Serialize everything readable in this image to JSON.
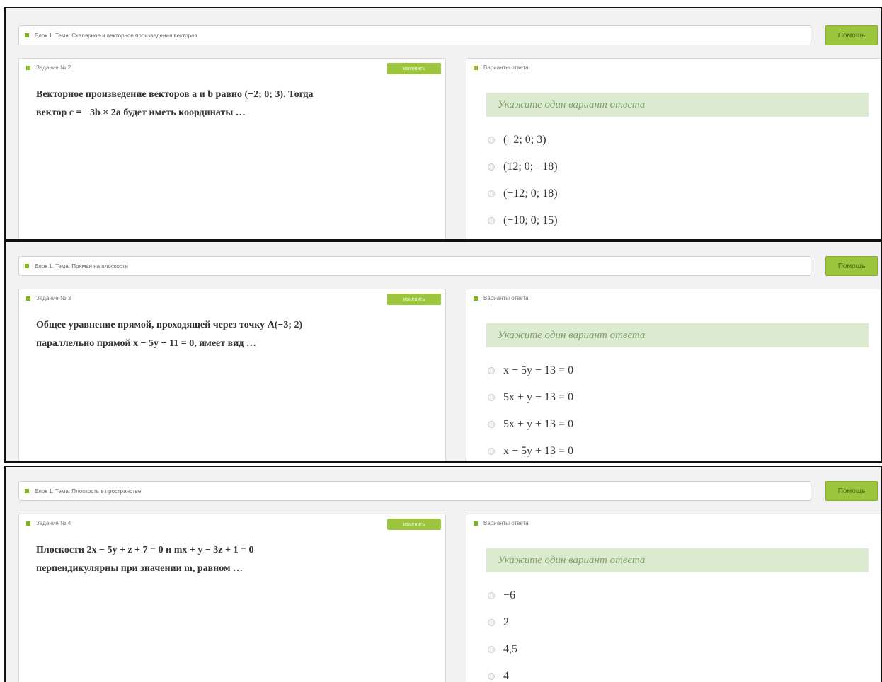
{
  "common": {
    "help_label": "Помощь",
    "change_label": "изменить",
    "answers_heading": "Варианты ответа",
    "hint": "Укажите один вариант ответа"
  },
  "screens": [
    {
      "topic": "Блок 1. Тема: Скалярное и векторное произведения векторов",
      "task_label": "Задание № 2",
      "question_line1": "Векторное произведение векторов a и b равно (−2; 0; 3). Тогда",
      "question_line2": "вектор c = −3b × 2a будет иметь координаты …",
      "options": [
        "(−2; 0; 3)",
        "(12; 0; −18)",
        "(−12; 0; 18)",
        "(−10; 0; 15)"
      ]
    },
    {
      "topic": "Блок 1. Тема: Прямая на плоскости",
      "task_label": "Задание № 3",
      "question_line1": "Общее уравнение прямой, проходящей через точку A(−3; 2)",
      "question_line2": "параллельно прямой x − 5y + 11 = 0, имеет вид …",
      "options": [
        "x − 5y − 13 = 0",
        "5x + y − 13 = 0",
        "5x + y + 13 = 0",
        "x − 5y + 13 = 0"
      ]
    },
    {
      "topic": "Блок 1. Тема: Плоскость в пространстве",
      "task_label": "Задание № 4",
      "question_line1": "Плоскости 2x − 5y + z + 7 = 0 и mx + y − 3z + 1 = 0",
      "question_line2": "перпендикулярны при значении m, равном …",
      "options": [
        "−6",
        "2",
        "4,5",
        "4"
      ]
    }
  ]
}
